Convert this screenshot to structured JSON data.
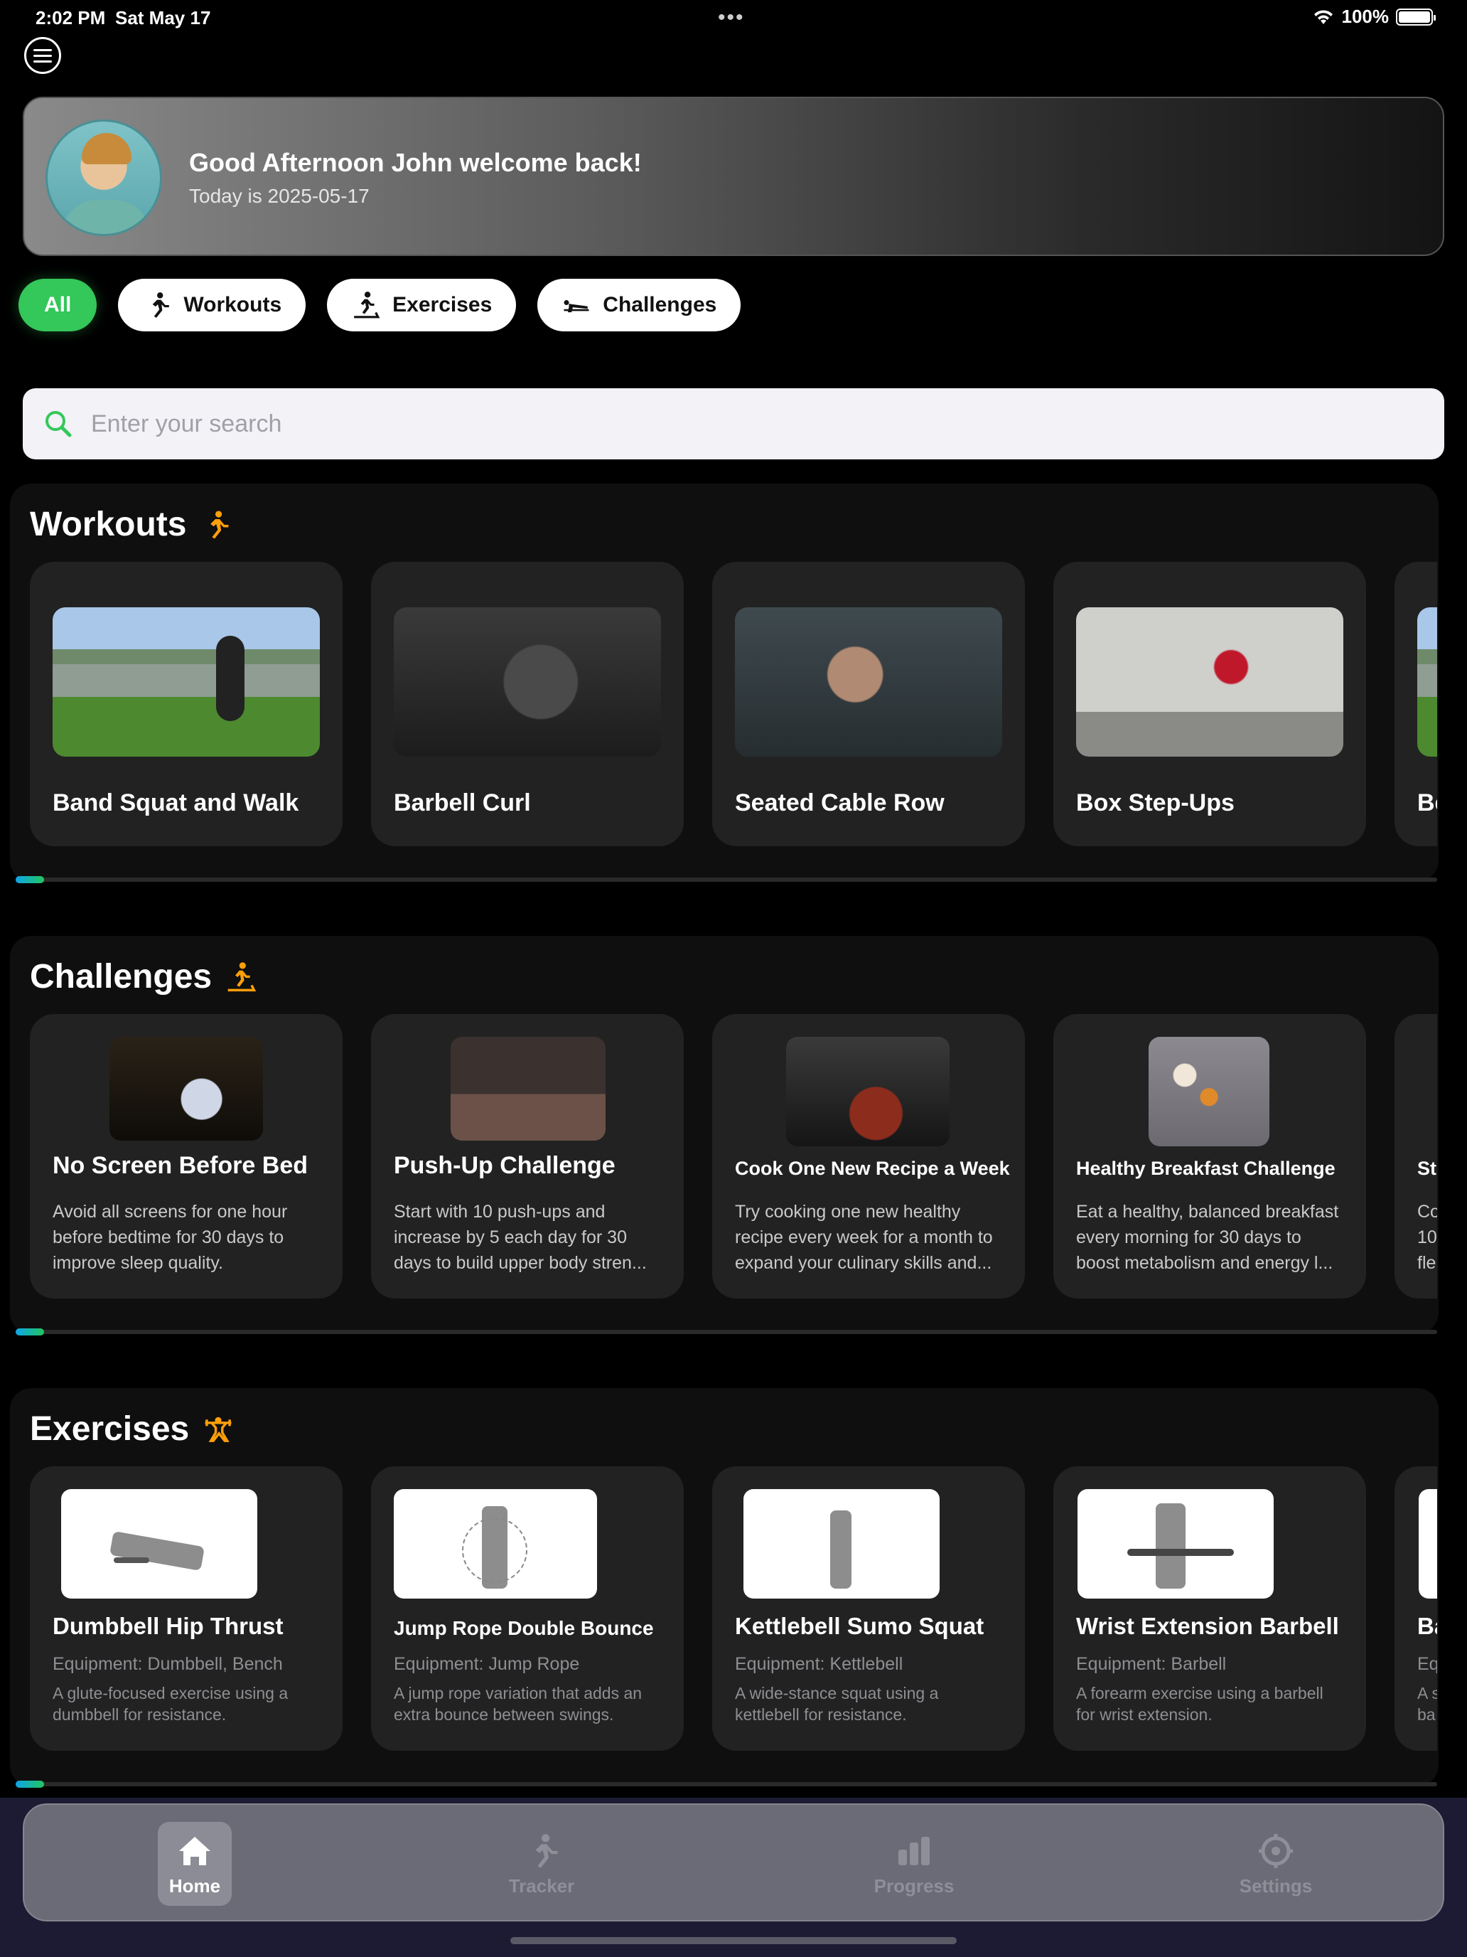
{
  "status_bar": {
    "time": "2:02 PM",
    "date": "Sat May 17",
    "battery": "100%"
  },
  "greeting": {
    "title": "Good Afternoon John welcome back!",
    "subtitle": "Today is 2025-05-17"
  },
  "filters": [
    {
      "label": "All",
      "active": true
    },
    {
      "label": "Workouts",
      "icon": "runner-icon"
    },
    {
      "label": "Exercises",
      "icon": "treadmill-icon"
    },
    {
      "label": "Challenges",
      "icon": "pushup-icon"
    }
  ],
  "search": {
    "placeholder": "Enter your search"
  },
  "workouts": {
    "title": "Workouts",
    "items": [
      {
        "name": "Band Squat and Walk"
      },
      {
        "name": "Barbell Curl"
      },
      {
        "name": "Seated Cable Row"
      },
      {
        "name": "Box Step-Ups"
      },
      {
        "name": "Be"
      }
    ]
  },
  "challenges": {
    "title": "Challenges",
    "items": [
      {
        "name": "No Screen Before Bed",
        "desc": "Avoid all screens for one hour before bedtime for 30 days to improve sleep quality."
      },
      {
        "name": "Push-Up Challenge",
        "desc": "Start with 10 push-ups and increase by 5 each day for 30 days to build upper body stren..."
      },
      {
        "name": "Cook One New Recipe a Week",
        "desc": "Try cooking one new healthy recipe every week for a month to expand your culinary skills and..."
      },
      {
        "name": "Healthy Breakfast Challenge",
        "desc": "Eat a healthy, balanced breakfast every morning for 30 days to boost metabolism and energy l..."
      },
      {
        "name": "St",
        "desc": "Co 10 fle"
      }
    ]
  },
  "exercises": {
    "title": "Exercises",
    "items": [
      {
        "name": "Dumbbell Hip Thrust",
        "equipment": "Equipment: Dumbbell, Bench",
        "desc": "A glute-focused exercise using a dumbbell for resistance."
      },
      {
        "name": "Jump Rope Double Bounce",
        "equipment": "Equipment: Jump Rope",
        "desc": "A jump rope variation that adds an extra bounce between swings."
      },
      {
        "name": "Kettlebell Sumo Squat",
        "equipment": "Equipment: Kettlebell",
        "desc": "A wide-stance squat using a kettlebell for resistance."
      },
      {
        "name": "Wrist Extension Barbell",
        "equipment": "Equipment: Barbell",
        "desc": "A forearm exercise using a barbell for wrist extension."
      },
      {
        "name": "Ba",
        "equipment": "Eq",
        "desc": "A s ba"
      }
    ]
  },
  "tabs": [
    {
      "label": "Home",
      "icon": "house-icon",
      "active": true
    },
    {
      "label": "Tracker",
      "icon": "runner-icon"
    },
    {
      "label": "Progress",
      "icon": "bar-chart-icon"
    },
    {
      "label": "Settings",
      "icon": "gear-icon"
    }
  ],
  "colors": {
    "accent": "#34c759",
    "orange_icon": "#ff9f0a",
    "card": "#222222",
    "tabbar": "#6b6b78"
  }
}
